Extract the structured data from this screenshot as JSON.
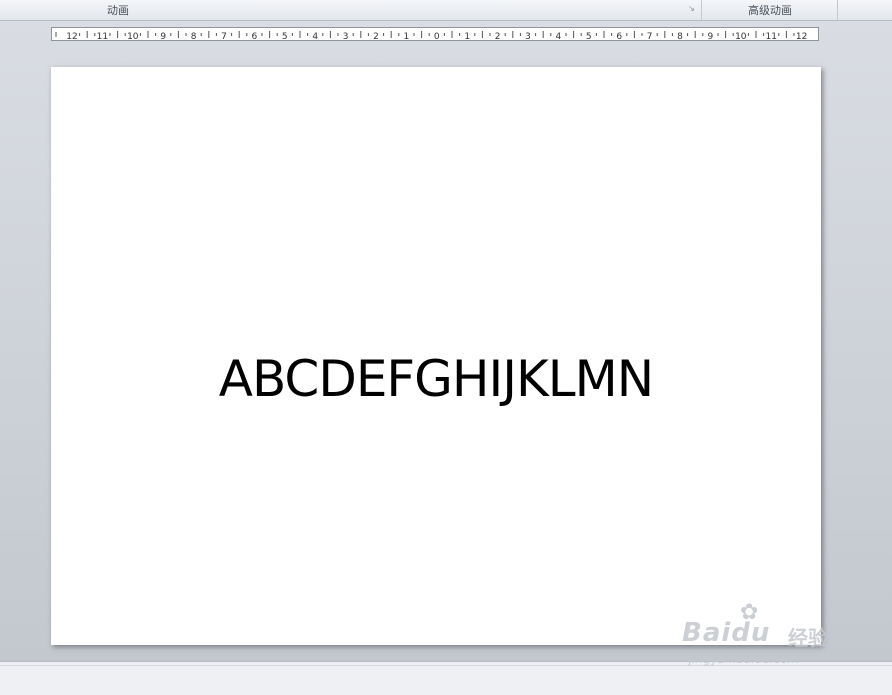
{
  "ribbon": {
    "group_animation_label": "动画",
    "group_advanced_animation_label": "高级动画",
    "launcher_icon": "dialog-launcher-icon"
  },
  "ruler": {
    "labels": [
      "12",
      "11",
      "10",
      "9",
      "8",
      "7",
      "6",
      "5",
      "4",
      "3",
      "2",
      "1",
      "0",
      "1",
      "2",
      "3",
      "4",
      "5",
      "6",
      "7",
      "8",
      "9",
      "10",
      "11",
      "12"
    ]
  },
  "slide": {
    "text": "ABCDEFGHIJKLMN"
  },
  "watermark": {
    "brand": "Baidu",
    "brand_cn": "经验",
    "url": "jingyan.baidu.com"
  }
}
